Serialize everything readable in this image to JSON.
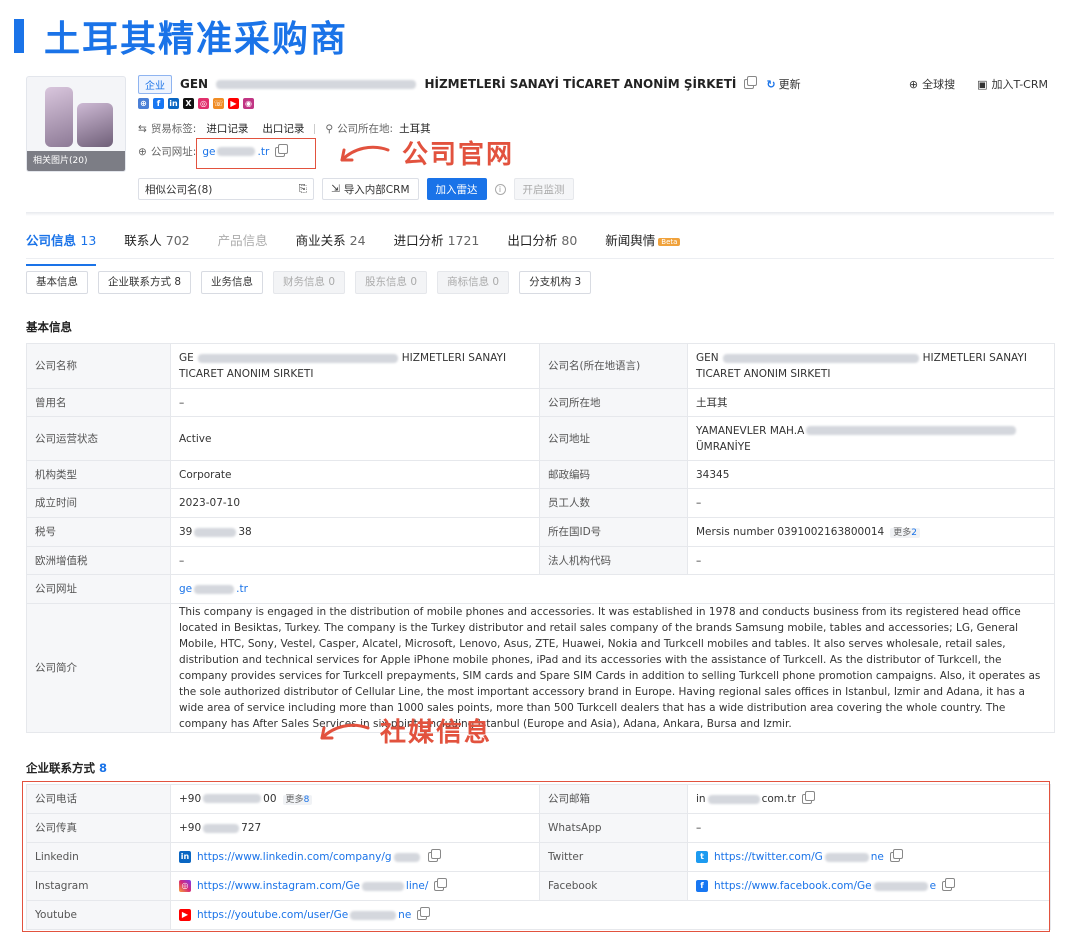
{
  "page_title": "土耳其精准采购商",
  "header": {
    "image_label": "相关图片(20)",
    "tag": "企业",
    "company_name_start": "GEN",
    "company_name_end": "HİZMETLERİ SANAYİ TİCARET ANONİM ŞİRKETİ",
    "update_label": "更新",
    "search_global": "全球搜",
    "add_crm": "加入T-CRM",
    "trade_tag_label": "贸易标签:",
    "import_record": "进口记录",
    "export_record": "出口记录",
    "location_label": "公司所在地:",
    "location_value": "土耳其",
    "website_label": "公司网址:",
    "website_start": "ge",
    "website_end": ".tr",
    "similar_label": "相似公司名(8)",
    "import_crm": "导入内部CRM",
    "add_radar": "加入雷达",
    "monitor": "开启监测"
  },
  "annotations": {
    "website": "公司官网",
    "social": "社媒信息"
  },
  "tabs": [
    {
      "label": "公司信息",
      "count": "13"
    },
    {
      "label": "联系人",
      "count": "702"
    },
    {
      "label": "产品信息",
      "count": ""
    },
    {
      "label": "商业关系",
      "count": "24"
    },
    {
      "label": "进口分析",
      "count": "1721"
    },
    {
      "label": "出口分析",
      "count": "80"
    },
    {
      "label": "新闻舆情",
      "count": "",
      "badge": "Beta"
    }
  ],
  "subtabs": [
    "基本信息",
    "企业联系方式 8",
    "业务信息",
    "财务信息 0",
    "股东信息 0",
    "商标信息 0",
    "分支机构 3"
  ],
  "basic": {
    "title": "基本信息",
    "company_name_k": "公司名称",
    "company_name_v1": "GE",
    "company_name_v2": "HIZMETLERI SANAYI",
    "company_name_v3": "TICARET ANONIM SIRKETI",
    "local_name_k": "公司名(所在地语言)",
    "local_name_v1": "GEN",
    "local_name_v2": "HIZMETLERI SANAYI",
    "local_name_v3": "TICARET ANONIM SIRKETI",
    "former_k": "曾用名",
    "former_v": "–",
    "loc_k": "公司所在地",
    "loc_v": "土耳其",
    "status_k": "公司运营状态",
    "status_v": "Active",
    "addr_k": "公司地址",
    "addr_v1": "YAMANEVLER MAH.A",
    "addr_v2": "ÜMRANİYE",
    "type_k": "机构类型",
    "type_v": "Corporate",
    "zip_k": "邮政编码",
    "zip_v": "34345",
    "founded_k": "成立时间",
    "founded_v": "2023-07-10",
    "staff_k": "员工人数",
    "staff_v": "–",
    "tax_k": "税号",
    "tax_v1": "39",
    "tax_v2": "38",
    "natid_k": "所在国ID号",
    "natid_v": "Mersis number 0391002163800014",
    "natid_more": "更多",
    "natid_more_n": "2",
    "vat_k": "欧洲增值税",
    "vat_v": "–",
    "legal_k": "法人机构代码",
    "legal_v": "–",
    "web_k": "公司网址",
    "web_v1": "ge",
    "web_v2": ".tr",
    "intro_k": "公司简介",
    "intro_v": "This company is engaged in the distribution of mobile phones and accessories. It was established in 1978 and conducts business from its registered head office located in Besiktas, Turkey. The company is the Turkey distributor and retail sales company of the brands Samsung mobile, tables and accessories; LG, General Mobile, HTC, Sony, Vestel, Casper, Alcatel, Microsoft, Lenovo, Asus, ZTE, Huawei, Nokia and Turkcell mobiles and tables. It also serves wholesale, retail sales, distribution and technical services for Apple iPhone mobile phones, iPad and its accessories with the assistance of Turkcell. As the distributor of Turkcell, the company provides services for Turkcell prepayments, SIM cards and Spare SIM Cards in addition to selling Turkcell phone promotion campaigns. Also, it operates as the sole authorized distributor of Cellular Line, the most important accessory brand in Europe. Having regional sales offices in Istanbul, Izmir and Adana, it has a wide area of service including more than 1000 sales points, more than 500 Turkcell dealers that has a wide distribution area covering the whole country. The company has After Sales Services in six points including Istanbul (Europe and Asia), Adana, Ankara, Bursa and Izmir."
  },
  "contact": {
    "title": "企业联系方式",
    "count": "8",
    "phone_k": "公司电话",
    "phone_v1": "+90",
    "phone_v2": "00",
    "phone_more": "更多",
    "phone_more_n": "8",
    "email_k": "公司邮箱",
    "email_v1": "in",
    "email_v2": "com.tr",
    "fax_k": "公司传真",
    "fax_v1": "+90",
    "fax_v2": "727",
    "whatsapp_k": "WhatsApp",
    "whatsapp_v": "–",
    "linkedin_k": "Linkedin",
    "linkedin_v1": "https://www.linkedin.com/company/g",
    "twitter_k": "Twitter",
    "twitter_v1": "https://twitter.com/G",
    "twitter_v2": "ne",
    "instagram_k": "Instagram",
    "instagram_v1": "https://www.instagram.com/Ge",
    "instagram_v2": "line/",
    "facebook_k": "Facebook",
    "facebook_v1": "https://www.facebook.com/Ge",
    "facebook_v2": "e",
    "youtube_k": "Youtube",
    "youtube_v1": "https://youtube.com/user/Ge",
    "youtube_v2": "ne"
  }
}
